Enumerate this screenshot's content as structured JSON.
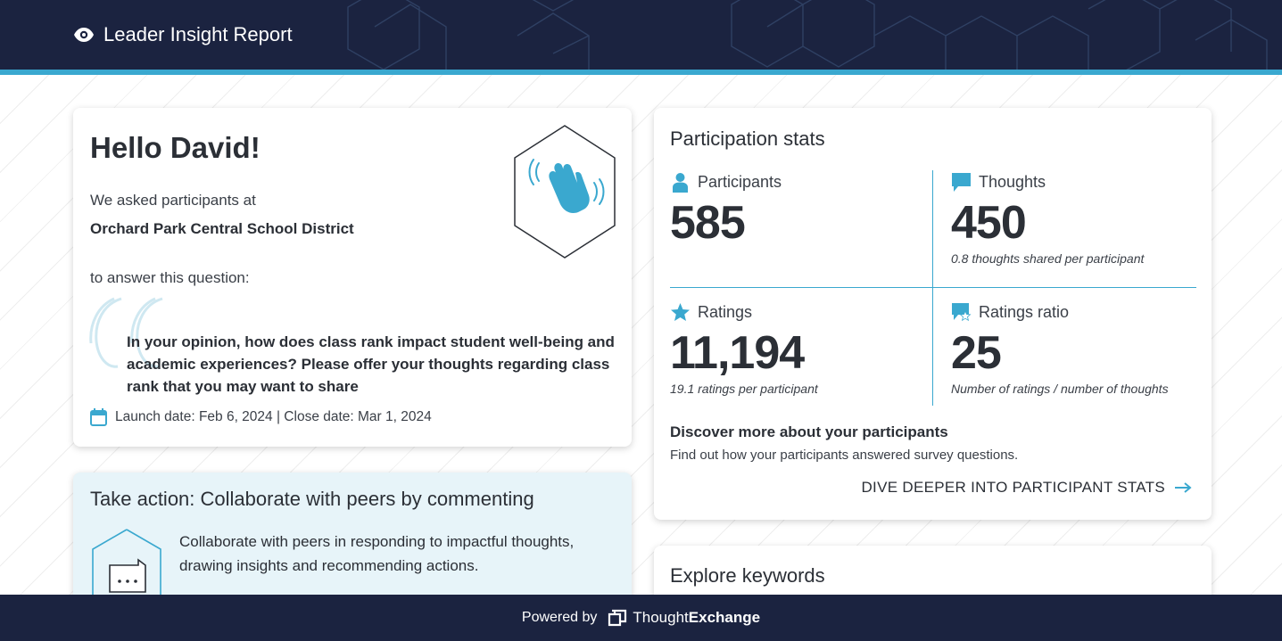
{
  "header": {
    "title": "Leader Insight Report",
    "icon": "eye-icon",
    "colors": {
      "bar": "#1b2340",
      "accent": "#3aa8cf"
    }
  },
  "hello_card": {
    "greeting": "Hello David!",
    "asked_text": "We asked participants at",
    "organization": "Orchard Park Central School District",
    "answer_text": "to answer this question:",
    "question": "In your opinion, how does class rank impact student well-being and academic experiences? Please offer your thoughts regarding class rank that you may want to share",
    "dates": "Launch date: Feb 6, 2024 | Close date: Mar 1, 2024",
    "icons": [
      "waving-hand-icon",
      "calendar-icon",
      "quote-icon"
    ]
  },
  "action_card": {
    "title": "Take action: Collaborate with peers by commenting",
    "text": "Collaborate with peers in responding to impactful thoughts, drawing insights and recommending actions.",
    "icon": "chat-bubble-icon"
  },
  "stats_card": {
    "title": "Participation stats",
    "participants": {
      "label": "Participants",
      "value": "585",
      "icon": "person-icon"
    },
    "thoughts": {
      "label": "Thoughts",
      "value": "450",
      "note": "0.8 thoughts shared per participant",
      "icon": "speech-bubble-icon"
    },
    "ratings": {
      "label": "Ratings",
      "value": "11,194",
      "note": "19.1 ratings per participant",
      "icon": "star-icon"
    },
    "ratio": {
      "label": "Ratings ratio",
      "value": "25",
      "note": "Number of ratings / number of thoughts",
      "icon": "ratio-star-icon"
    },
    "discover_title": "Discover more about your participants",
    "discover_text": "Find out how your participants answered survey questions.",
    "link": "DIVE DEEPER INTO PARTICIPANT STATS"
  },
  "keywords_card": {
    "title": "Explore keywords"
  },
  "footer": {
    "powered_by": "Powered by",
    "brand_light": "Thought",
    "brand_bold": "Exchange"
  }
}
